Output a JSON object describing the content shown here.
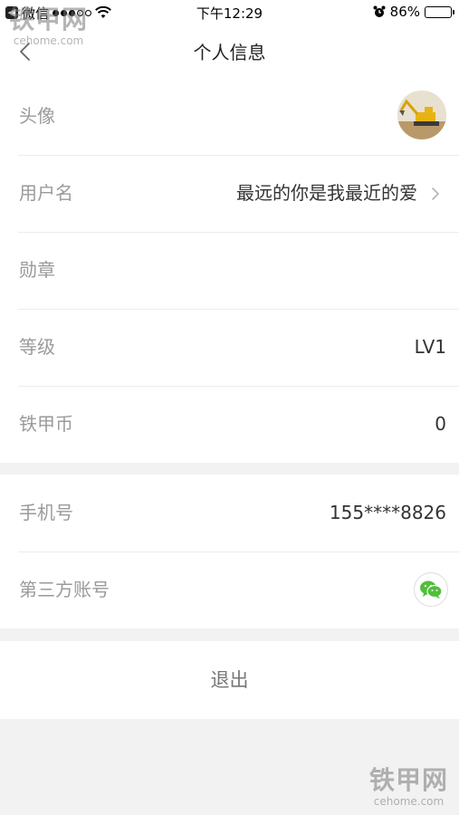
{
  "status_bar": {
    "carrier": "微信",
    "time": "下午12:29",
    "battery": "86%",
    "battery_level": 0.86
  },
  "nav": {
    "title": "个人信息",
    "back_icon": "chevron-left-icon"
  },
  "profile": {
    "avatar_label": "头像",
    "username_label": "用户名",
    "username_value": "最远的你是我最近的爱",
    "medal_label": "勋章",
    "medal_value": "",
    "level_label": "等级",
    "level_value": "LV1",
    "coin_label": "铁甲币",
    "coin_value": "0"
  },
  "account": {
    "phone_label": "手机号",
    "phone_value": "155****8826",
    "third_party_label": "第三方账号",
    "third_party_icon": "wechat-icon"
  },
  "logout_label": "退出",
  "watermark": {
    "cn": "铁甲网",
    "en": "cehome.com"
  },
  "colors": {
    "background": "#f2f2f2",
    "card": "#ffffff",
    "label": "#9a9a9a",
    "value": "#333333",
    "wechat": "#4fbf3a"
  }
}
